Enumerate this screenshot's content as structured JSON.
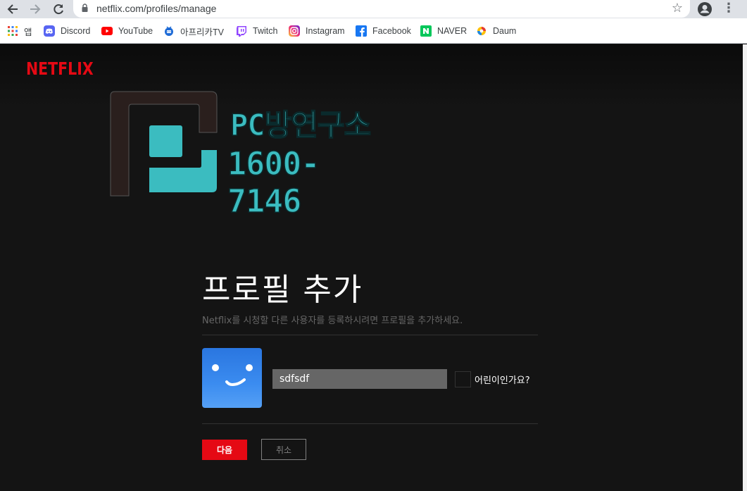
{
  "browser": {
    "url": "netflix.com/profiles/manage",
    "bookmarks": [
      {
        "label": "앱",
        "icon": "apps-grid-icon"
      },
      {
        "label": "Discord",
        "icon": "discord-icon"
      },
      {
        "label": "YouTube",
        "icon": "youtube-icon"
      },
      {
        "label": "아프리카TV",
        "icon": "afreecatv-icon"
      },
      {
        "label": "Twitch",
        "icon": "twitch-icon"
      },
      {
        "label": "Instagram",
        "icon": "instagram-icon"
      },
      {
        "label": "Facebook",
        "icon": "facebook-icon"
      },
      {
        "label": "NAVER",
        "icon": "naver-icon"
      },
      {
        "label": "Daum",
        "icon": "daum-icon"
      }
    ]
  },
  "header": {
    "logo": "NETFLIX"
  },
  "watermark": {
    "line1": "PC방연구소",
    "line2": "1600-7146"
  },
  "main": {
    "title": "프로필 추가",
    "subtitle": "Netflix를 시청할 다른 사용자를 등록하시려면 프로필을 추가하세요.",
    "name_value": "sdfsdf",
    "kids_label": "어린이인가요?",
    "next_label": "다음",
    "cancel_label": "취소"
  },
  "colors": {
    "brand": "#e50914",
    "background": "#141414",
    "watermark": "#3bbcc0"
  }
}
